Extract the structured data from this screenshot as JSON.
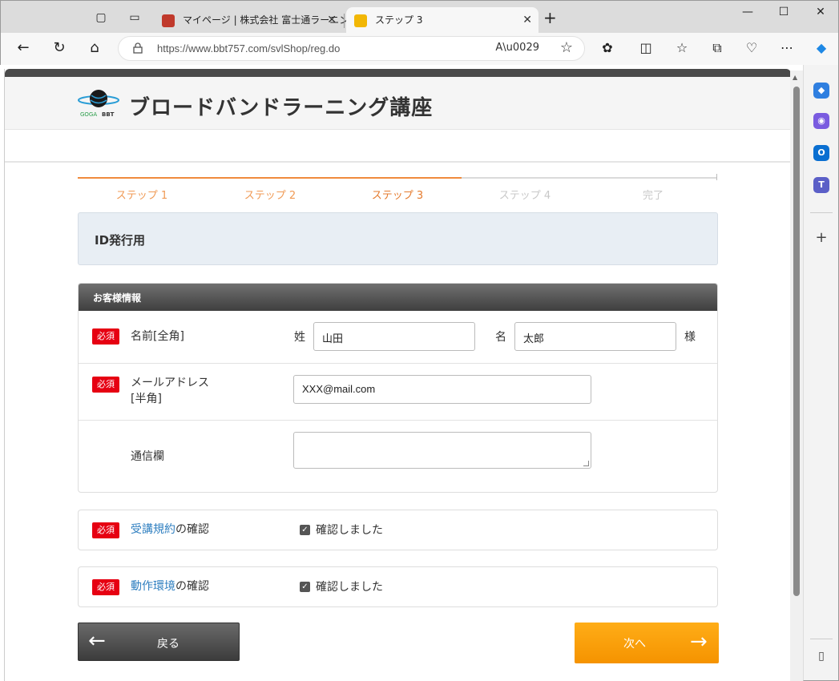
{
  "browser": {
    "tabs": [
      {
        "title": "マイページ | 株式会社 富士通ラーニン",
        "active": false
      },
      {
        "title": "ステップ 3",
        "active": true
      }
    ],
    "url": "https://www.bbt757.com/svlShop/reg.do",
    "read_aloud": "A)"
  },
  "header": {
    "site_title": "ブロードバンドラーニング講座",
    "logo_text": "BBT"
  },
  "steps": [
    {
      "label": "ステップ 1",
      "state": "done"
    },
    {
      "label": "ステップ 2",
      "state": "done"
    },
    {
      "label": "ステップ 3",
      "state": "current"
    },
    {
      "label": "ステップ 4",
      "state": "todo"
    },
    {
      "label": "完了",
      "state": "todo"
    }
  ],
  "id_box": {
    "title": "ID発行用"
  },
  "customer": {
    "section_title": "お客様情報",
    "required_badge": "必須",
    "name_label": "名前[全角]",
    "last_name_prefix": "姓",
    "last_name_value": "山田",
    "first_name_prefix": "名",
    "first_name_value": "太郎",
    "honorific": "様",
    "email_label_1": "メールアドレス",
    "email_label_2": "[半角]",
    "email_value": "XXX@mail.com",
    "message_label": "通信欄"
  },
  "confirmations": [
    {
      "link": "受講規約",
      "suffix": "の確認",
      "check_label": "確認しました",
      "checked": true
    },
    {
      "link": "動作環境",
      "suffix": "の確認",
      "check_label": "確認しました",
      "checked": true
    }
  ],
  "buttons": {
    "back": "戻る",
    "next": "次へ"
  },
  "colors": {
    "accent_orange": "#f59300",
    "required_red": "#e60012",
    "link_blue": "#2f7fc0"
  }
}
